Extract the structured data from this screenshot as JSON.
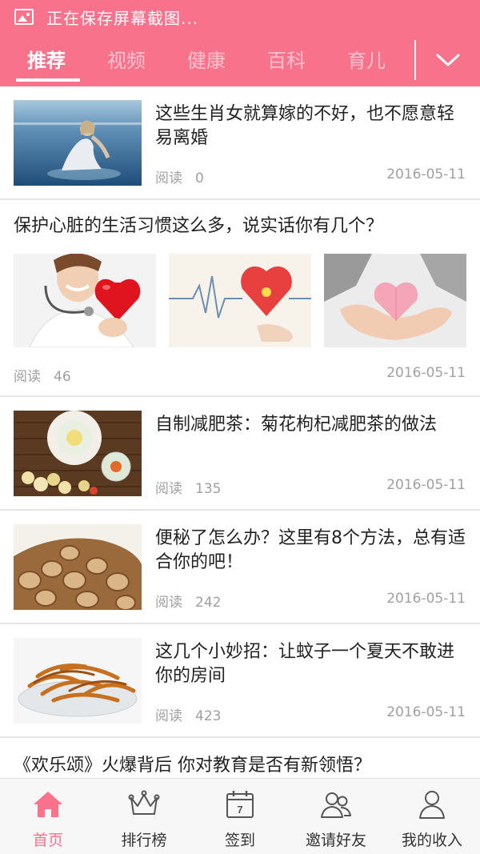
{
  "status_bar": {
    "text": "正在保存屏幕截图..."
  },
  "tabs": [
    {
      "label": "推荐",
      "active": true
    },
    {
      "label": "视频",
      "active": false
    },
    {
      "label": "健康",
      "active": false
    },
    {
      "label": "百科",
      "active": false
    },
    {
      "label": "育儿",
      "active": false
    }
  ],
  "theme": {
    "accent": "#f9728c",
    "inactive_tab": "#ffc3cf",
    "meta_gray": "#a0a0a0"
  },
  "feed": {
    "read_label": "阅读",
    "articles": [
      {
        "title": "这些生肖女就算嫁的不好，也不愿意轻易离婚",
        "reads": "0",
        "date": "2016-05-11",
        "image": "woman-sitting-in-water-photo"
      },
      {
        "title": "保护心脏的生活习惯这么多，说实话你有几个？",
        "reads": "46",
        "date": "2016-05-11",
        "images": [
          "doctor-with-stethoscope-heart-photo",
          "heartbeat-line-heart-photo",
          "hands-holding-paper-heart-photo"
        ]
      },
      {
        "title": "自制减肥茶：菊花枸杞减肥茶的做法",
        "reads": "135",
        "date": "2016-05-11",
        "image": "chrysanthemum-tea-photo"
      },
      {
        "title": "便秘了怎么办？这里有8个方法，总有适合你的吧！",
        "reads": "242",
        "date": "2016-05-11",
        "image": "sliced-herbs-photo"
      },
      {
        "title": "这几个小妙招：让蚊子一个夏天不敢进你的房间",
        "reads": "423",
        "date": "2016-05-11",
        "image": "orange-peel-bowl-photo"
      },
      {
        "title": "《欢乐颂》火爆背后 你对教育是否有新领悟？"
      }
    ]
  },
  "bottom_nav": [
    {
      "label": "首页",
      "icon": "home-icon",
      "active": true
    },
    {
      "label": "排行榜",
      "icon": "crown-icon",
      "active": false
    },
    {
      "label": "签到",
      "icon": "calendar-icon",
      "active": false,
      "badge": "7"
    },
    {
      "label": "邀请好友",
      "icon": "invite-friends-icon",
      "active": false
    },
    {
      "label": "我的收入",
      "icon": "user-icon",
      "active": false
    }
  ]
}
